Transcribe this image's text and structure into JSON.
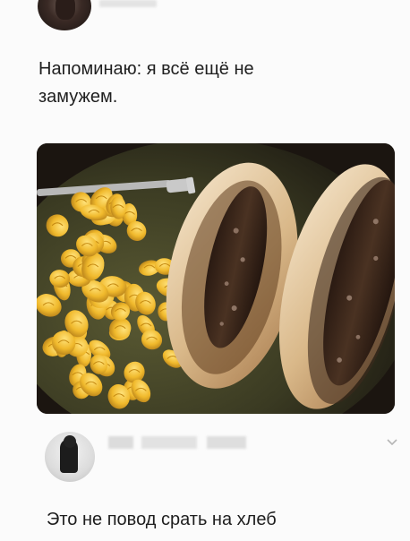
{
  "post": {
    "text": "Напоминаю: я всё ещё не замужем."
  },
  "comment": {
    "text": "Это не повод срать на хлеб"
  }
}
